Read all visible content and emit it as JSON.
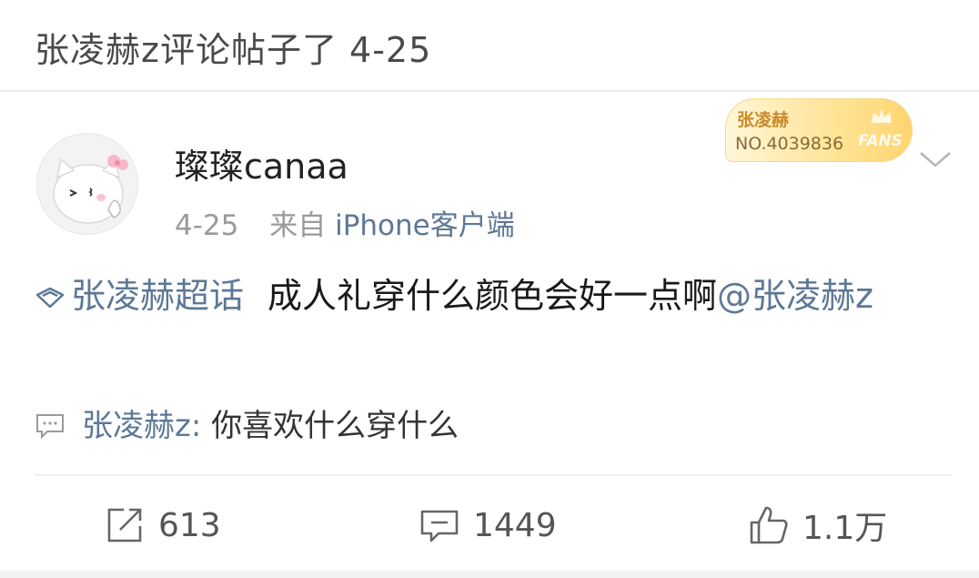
{
  "header": {
    "title": "张凌赫z评论帖子了 4-25"
  },
  "post": {
    "author": "璨璨canaa",
    "date": "4-25",
    "source_prefix": "来自",
    "source_device": "iPhone客户端",
    "fans_badge": {
      "name": "张凌赫",
      "number": "NO.4039836",
      "label": "FANS"
    },
    "topic": "张凌赫超话",
    "text": "成人礼穿什么颜色会好一点啊",
    "mention": "@张凌赫z",
    "reply": {
      "author": "张凌赫z:",
      "text": " 你喜欢什么穿什么"
    }
  },
  "actions": {
    "repost_count": "613",
    "comment_count": "1449",
    "like_count": "1.1万"
  },
  "colors": {
    "link": "#5d7896",
    "muted": "#9a9a9a",
    "badge_gold": "#ffd470"
  },
  "icons": [
    "avatar-kitty",
    "crown-icon",
    "chevron-down-icon",
    "supertopic-icon",
    "comment-bubble-icon",
    "repost-icon",
    "like-icon"
  ]
}
